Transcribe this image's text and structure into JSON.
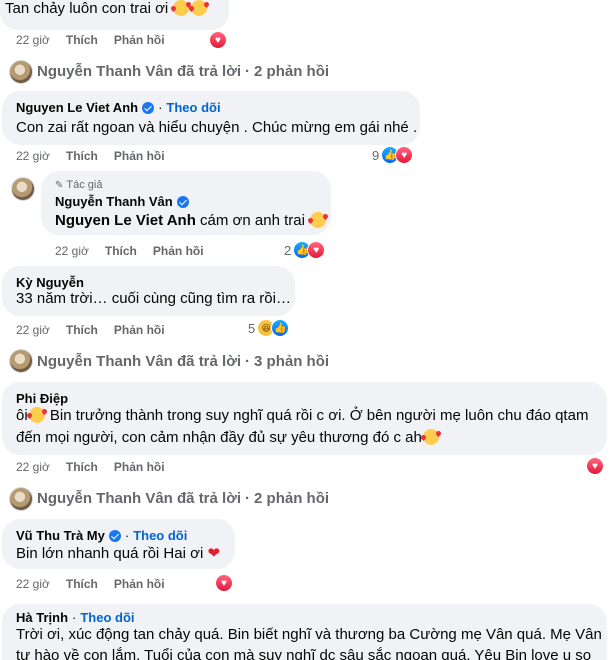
{
  "top_comment": {
    "text": "Tan chảy luôn con trai ơi",
    "time": "22 giờ",
    "like": "Thích",
    "reply": "Phản hồi"
  },
  "thread1": {
    "summary_name": "Nguyễn Thanh Vân",
    "summary_text": "đã trả lời",
    "summary_count": "2 phản hồi"
  },
  "c1": {
    "name": "Nguyen Le Viet Anh",
    "follow": "Theo dõi",
    "text": "Con zai rất ngoan và hiểu chuyện . Chúc mừng em gái nhé .",
    "time": "22 giờ",
    "like": "Thích",
    "reply": "Phản hồi",
    "react_count": "9"
  },
  "c1r": {
    "badge": "Tác giả",
    "name": "Nguyễn Thanh Vân",
    "mention": "Nguyen Le Viet Anh",
    "text": "cám ơn anh trai",
    "time": "22 giờ",
    "like": "Thích",
    "reply": "Phản hồi",
    "react_count": "2"
  },
  "c2": {
    "name": "Kỳ Nguyễn",
    "text": "33 năm trời… cuối cùng cũng tìm ra rồi…",
    "time": "22 giờ",
    "like": "Thích",
    "reply": "Phản hồi",
    "react_count": "5"
  },
  "thread2": {
    "summary_name": "Nguyễn Thanh Vân",
    "summary_text": "đã trả lời",
    "summary_count": "3 phản hồi"
  },
  "c3": {
    "name": "Phi Điệp",
    "line1_a": "ôi",
    "line1_b": " Bin trưởng thành trong suy nghĩ quá rồi c ơi. Ở bên người mẹ luôn chu đáo qtam",
    "line2": "đến mọi người, con cảm nhận đầy đủ sự yêu thương đó c ah",
    "time": "22 giờ",
    "like": "Thích",
    "reply": "Phản hồi"
  },
  "thread3": {
    "summary_name": "Nguyễn Thanh Vân",
    "summary_text": "đã trả lời",
    "summary_count": "2 phản hồi"
  },
  "c4": {
    "name": "Vũ Thu Trà My",
    "follow": "Theo dõi",
    "text": "Bin lớn nhanh quá rồi Hai ơi",
    "time": "22 giờ",
    "like": "Thích",
    "reply": "Phản hồi"
  },
  "c5": {
    "name": "Hà Trịnh",
    "follow": "Theo dõi",
    "line1": "Trời ơi, xúc động tan chảy quá. Bin biết nghĩ và thương ba Cường mẹ Vân quá. Mẹ Vân",
    "line2": "tự hào về con lắm. Tuổi của con mà suy nghĩ dc sâu sắc ngoan quá. Yêu Bin love u so"
  },
  "colors": {
    "bubble": "#f0f2f5",
    "meta": "#65676b",
    "link": "#0064d1",
    "like": "#1877f2",
    "love": "#e41e3f"
  }
}
